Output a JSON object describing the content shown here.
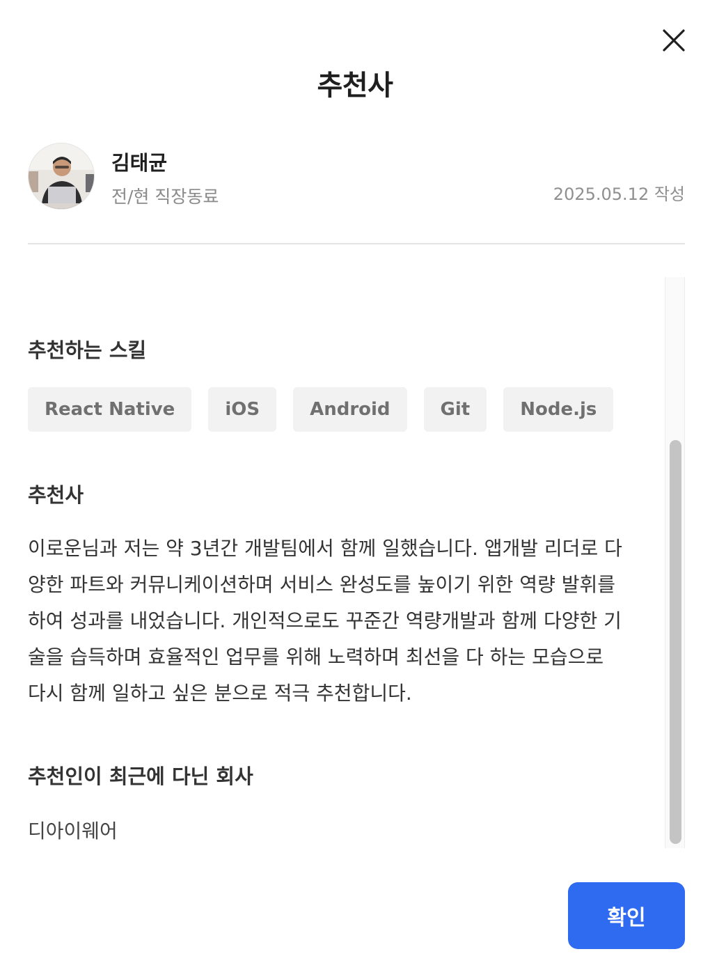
{
  "modal": {
    "title": "추천사",
    "confirm_label": "확인"
  },
  "recommender": {
    "name": "김태균",
    "relation": "전/현 직장동료",
    "written_date": "2025.05.12 작성"
  },
  "sections": {
    "skills_title": "추천하는 스킬",
    "skills": [
      "React Native",
      "iOS",
      "Android",
      "Git",
      "Node.js"
    ],
    "recommendation_title": "추천사",
    "recommendation_lines": [
      "이로운님과 저는 약 3년간 개발팀에서 함께 일했습니다. 앱개발 리더로 다",
      "양한 파트와 커뮤니케이션하며 서비스 완성도를 높이기 위한 역량 발휘를",
      "하여 성과를 내었습니다. 개인적으로도 꾸준간 역량개발과 함께 다양한 기",
      "술을 습득하며 효율적인 업무를 위해 노력하며 최선을 다 하는 모습으로",
      "다시 함께 일하고 싶은 분으로 적극 추천합니다."
    ],
    "company_title": "추천인이 최근에 다닌 회사",
    "company": "디아이웨어"
  },
  "icons": {
    "close": "close-icon",
    "avatar": "avatar-photo"
  },
  "colors": {
    "primary": "#2f6bf0",
    "chip_bg": "#f2f2f2",
    "muted_text": "#8a8a8a"
  }
}
